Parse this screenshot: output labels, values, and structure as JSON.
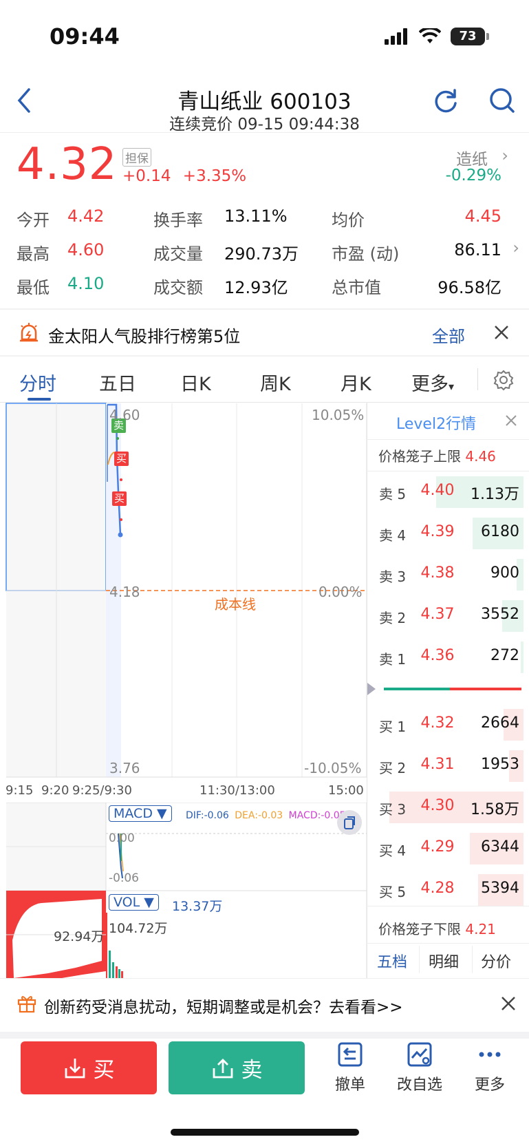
{
  "status": {
    "time": "09:44",
    "battery": "73"
  },
  "header": {
    "title": "青山纸业 600103",
    "subtitle": "连续竞价 09-15 09:44:38"
  },
  "quote": {
    "price": "4.32",
    "badge": "担保",
    "change": "+0.14",
    "change_pct": "+3.35%",
    "sector_name": "造纸",
    "sector_pct": "-0.29%"
  },
  "stats": {
    "open_label": "今开",
    "open": "4.42",
    "high_label": "最高",
    "high": "4.60",
    "low_label": "最低",
    "low": "4.10",
    "turnover_rate_label": "换手率",
    "turnover_rate": "13.11%",
    "volume_label": "成交量",
    "volume": "290.73万",
    "amount_label": "成交额",
    "amount": "12.93亿",
    "avg_label": "均价",
    "avg": "4.45",
    "pe_label": "市盈 (动)",
    "pe": "86.11",
    "mcap_label": "总市值",
    "mcap": "96.58亿"
  },
  "banner": {
    "text": "金太阳人气股排行榜第5位",
    "all": "全部"
  },
  "tabs": [
    "分时",
    "五日",
    "日K",
    "周K",
    "月K",
    "更多"
  ],
  "chart": {
    "price_top": "4.60",
    "pct_top": "10.05%",
    "price_mid": "4.18",
    "pct_mid": "0.00%",
    "price_bot": "3.76",
    "pct_bot": "-10.05%",
    "cost_line": "成本线",
    "marker_sell": "卖",
    "marker_buy": "买",
    "time_labels": [
      "9:15",
      "9:20",
      "9:25/9:30",
      "11:30/13:00",
      "15:00"
    ],
    "macd_label": "MACD ▼",
    "dif": "DIF:-0.06",
    "dea": "DEA:-0.03",
    "macd": "MACD:-0.05",
    "macd_top": "0.00",
    "macd_bot": "-0.06",
    "vol_label": "VOL ▼",
    "vol_value": "13.37万",
    "vol_max": "104.72万",
    "auction_vol": "92.94万"
  },
  "level2": {
    "title": "Level2行情",
    "upper_label": "价格笼子上限",
    "upper": "4.46",
    "lower_label": "价格笼子下限",
    "lower": "4.21",
    "asks": [
      {
        "label": "卖 5",
        "price": "4.40",
        "vol": "1.13万"
      },
      {
        "label": "卖 4",
        "price": "4.39",
        "vol": "6180"
      },
      {
        "label": "卖 3",
        "price": "4.38",
        "vol": "900"
      },
      {
        "label": "卖 2",
        "price": "4.37",
        "vol": "3552"
      },
      {
        "label": "卖 1",
        "price": "4.36",
        "vol": "272"
      }
    ],
    "bids": [
      {
        "label": "买 1",
        "price": "4.32",
        "vol": "2664"
      },
      {
        "label": "买 2",
        "price": "4.31",
        "vol": "1953"
      },
      {
        "label": "买 3",
        "price": "4.30",
        "vol": "1.58万"
      },
      {
        "label": "买 4",
        "price": "4.29",
        "vol": "6344"
      },
      {
        "label": "买 5",
        "price": "4.28",
        "vol": "5394"
      }
    ],
    "tabs": [
      "五档",
      "明细",
      "分价"
    ]
  },
  "news": {
    "text": "创新药受消息扰动，短期调整或是机会？去看看>>"
  },
  "actions": {
    "buy": "买",
    "sell": "卖",
    "cancel": "撤单",
    "watch": "改自选",
    "more": "更多"
  },
  "colors": {
    "up": "#f23b3b",
    "down": "#1aaa88",
    "accent": "#2a5db0"
  }
}
